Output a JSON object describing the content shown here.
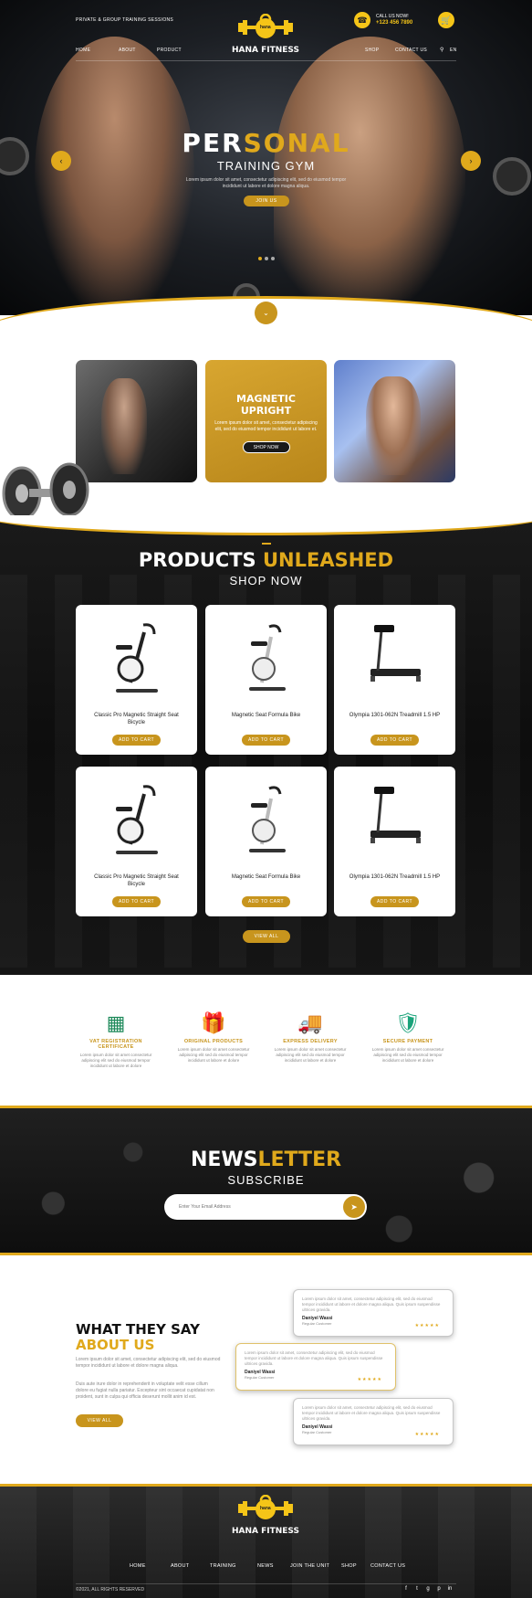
{
  "colors": {
    "accent": "#e0a91c",
    "dark": "#111111"
  },
  "topbar": {
    "tagline": "PRIVATE & GROUP TRAINING SESSIONS",
    "call_label": "CALL US NOW!",
    "phone": "+123 456 7890",
    "brand": "HANA FITNESS",
    "logo_text": "hana"
  },
  "nav": {
    "left": [
      "HOME",
      "ABOUT",
      "PRODUCT"
    ],
    "right": [
      "SHOP",
      "CONTACT US"
    ],
    "lang": "EN"
  },
  "hero": {
    "title_gold": "PER",
    "title_white": "SONAL",
    "subtitle": "TRAINING GYM",
    "text": "Lorem ipsum dolor sit amet, consectetur adipiscing elit, sed do eiusmod tempor incididunt ut labore et dolore magna aliqua.",
    "cta": "JOIN US"
  },
  "promo": {
    "title": "MAGNETIC UPRIGHT",
    "text": "Lorem ipsum dolor sit amet, consectetur adipiscing elit, sed do eiusmod tempor incididunt ut labore et.",
    "cta": "SHOP NOW"
  },
  "products": {
    "title_white": "PRODUCTS ",
    "title_gold": "UNLEASHED",
    "subtitle": "SHOP NOW",
    "button_label": "ADD TO CART",
    "view_all": "VIEW ALL",
    "items": [
      {
        "name": "Classic Pro Magnetic Straight Seat Bicycle",
        "icon": "exercise-bike"
      },
      {
        "name": "Magnetic Seat Formula Bike",
        "icon": "upright-bike"
      },
      {
        "name": "Olympia 1301-062N Treadmill 1.5 HP",
        "icon": "treadmill"
      },
      {
        "name": "Classic Pro Magnetic Straight Seat Bicycle",
        "icon": "exercise-bike"
      },
      {
        "name": "Magnetic Seat Formula Bike",
        "icon": "upright-bike"
      },
      {
        "name": "Olympia 1301-062N Treadmill 1.5 HP",
        "icon": "treadmill"
      }
    ]
  },
  "features": [
    {
      "title": "VAT REGISTRATION CERTIFICATE",
      "text": "Lorem ipsum dolor sit amet consectetur adipiscing elit sed do eiusmod tempor incididunt ut labore et dolore",
      "icon": "vat-icon"
    },
    {
      "title": "ORIGINAL PRODUCTS",
      "text": "Lorem ipsum dolor sit amet consectetur adipiscing elit sed do eiusmod tempor incididunt ut labore et dolore",
      "icon": "gift-icon"
    },
    {
      "title": "EXPRESS DELIVERY",
      "text": "Lorem ipsum dolor sit amet consectetur adipiscing elit sed do eiusmod tempor incididunt ut labore et dolore",
      "icon": "truck-icon"
    },
    {
      "title": "SECURE PAYMENT",
      "text": "Lorem ipsum dolor sit amet consectetur adipiscing elit sed do eiusmod tempor incididunt ut labore et dolore",
      "icon": "shield-icon"
    }
  ],
  "newsletter": {
    "title_white": "NEWS",
    "title_gold": "LETTER",
    "subtitle": "SUBSCRIBE",
    "placeholder": "Enter Your Email Address"
  },
  "testimonials": {
    "heading_1": "WHAT THEY SAY",
    "heading_2": "ABOUT US",
    "para_1": "Lorem ipsum dolor sit amet, consectetur adipiscing elit, sed do eiusmod tempor incididunt ut labore et dolore magna aliqua.",
    "para_2": "Duis aute irure dolor in reprehenderit in voluptate velit esse cillum dolore eu fugiat nulla pariatur. Excepteur sint occaecat cupidatat non proident, sunt in culpa qui officia deserunt mollit anim id est.",
    "cta": "VIEW ALL",
    "items": [
      {
        "text": "Lorem ipsum dolor sit amet, consectetur adipiscing elit, sed do eiusmod tempor incididunt ut labore et dolore magna aliqua. Quis ipsum suspendisse ultrices gravida.",
        "name": "Daniyel Wassi",
        "role": "Regular Customer",
        "stars": "★★★★★"
      },
      {
        "text": "Lorem ipsum dolor sit amet, consectetur adipiscing elit, sed do eiusmod tempor incididunt ut labore et dolore magna aliqua. Quis ipsum suspendisse ultrices gravida.",
        "name": "Daniyel Wassi",
        "role": "Regular Customer",
        "stars": "★★★★★"
      },
      {
        "text": "Lorem ipsum dolor sit amet, consectetur adipiscing elit, sed do eiusmod tempor incididunt ut labore et dolore magna aliqua. Quis ipsum suspendisse ultrices gravida.",
        "name": "Daniyel Wassi",
        "role": "Regular Customer",
        "stars": "★★★★★"
      }
    ]
  },
  "footer": {
    "brand": "HANA FITNESS",
    "logo_text": "hana",
    "links": [
      "HOME",
      "ABOUT",
      "TRAINING",
      "NEWS",
      "JOIN THE UNIT",
      "SHOP",
      "CONTACT US"
    ],
    "copyright": "©2021, ALL RIGHTS RESERVED",
    "social": [
      "f",
      "t",
      "g",
      "p",
      "in"
    ]
  }
}
